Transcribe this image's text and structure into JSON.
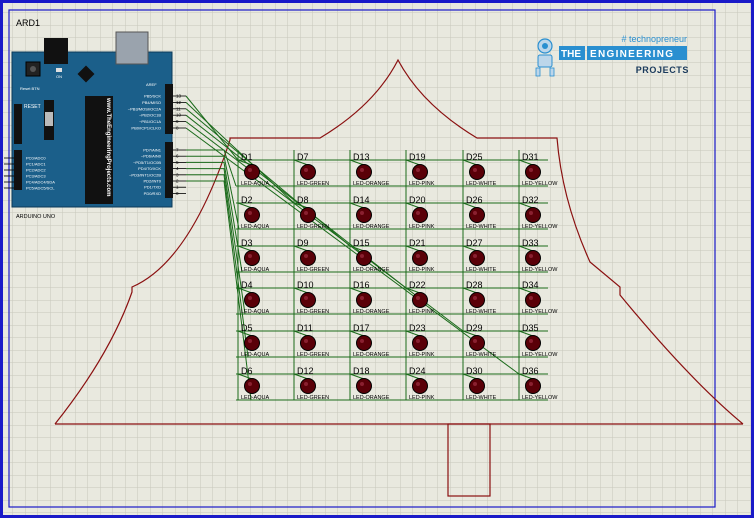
{
  "arduino": {
    "ref": "ARD1",
    "name": "ARDUINO UNO",
    "board_text": "www.TheEngineeringProjects.com",
    "reset_label": "RESET",
    "aref_label": "AREF",
    "reset_btn_label": "Reset BTN",
    "on_label": "ON",
    "left_pins": [
      "PC0/ADC0",
      "PC1/ADC1",
      "PC2/ADC2",
      "PC3/ADC3",
      "PC4/ADC4/SDA",
      "PC5/ADC5/SCL"
    ],
    "right_pins_top": [
      "PB5/SCK",
      "PB4/MISO",
      "~PB3/MOSI/OC2A",
      "~PB2/OC1B",
      "~PB1/OC1A",
      "PB0/ICP1/CLKO"
    ],
    "right_pins_top_nums": [
      "13",
      "12",
      "11",
      "10",
      "9",
      "8"
    ],
    "right_pins_bottom": [
      "PD7/AIN1",
      "~PD6/AIN0",
      "~PD5/T1/OC0B",
      "PD4/T0/XCK",
      "~PD3/INT1/OC2B",
      "PD2/INT0",
      "PD1/TXD",
      "PD0/RXD"
    ],
    "right_pins_bottom_nums": [
      "7",
      "6",
      "5",
      "4",
      "3",
      "2",
      "1",
      "0"
    ]
  },
  "logo": {
    "tagline": "# technopreneur",
    "line1_a": "THE",
    "line1_b": "ENGINEERING",
    "line2": "PROJECTS"
  },
  "led_colors": {
    "LED-AQUA": "#5a0008",
    "LED-GREEN": "#5a0008",
    "LED-ORANGE": "#5a0008",
    "LED-PINK": "#5a0008",
    "LED-WHITE": "#5a0008",
    "LED-YELLOW": "#5a0008"
  },
  "leds": {
    "columns": [
      {
        "type": "LED-AQUA",
        "labels": [
          "D1",
          "D2",
          "D3",
          "D4",
          "D5",
          "D6"
        ]
      },
      {
        "type": "LED-GREEN",
        "labels": [
          "D7",
          "D8",
          "D9",
          "D10",
          "D11",
          "D12"
        ]
      },
      {
        "type": "LED-ORANGE",
        "labels": [
          "D13",
          "D14",
          "D15",
          "D16",
          "D17",
          "D18"
        ]
      },
      {
        "type": "LED-PINK",
        "labels": [
          "D19",
          "D20",
          "D21",
          "D22",
          "D23",
          "D24"
        ]
      },
      {
        "type": "LED-WHITE",
        "labels": [
          "D25",
          "D26",
          "D27",
          "D28",
          "D29",
          "D30"
        ]
      },
      {
        "type": "LED-YELLOW",
        "labels": [
          "D31",
          "D32",
          "D33",
          "D34",
          "D35",
          "D36"
        ]
      }
    ]
  },
  "colors": {
    "grid_bg": "#e9e9df",
    "grid_line": "#c7c7bb",
    "frame": "#1a1ac8",
    "outline": "#8a1010",
    "wire": "#1a6a1a",
    "board": "#1b5f8a",
    "accent": "#2a8fd0"
  }
}
